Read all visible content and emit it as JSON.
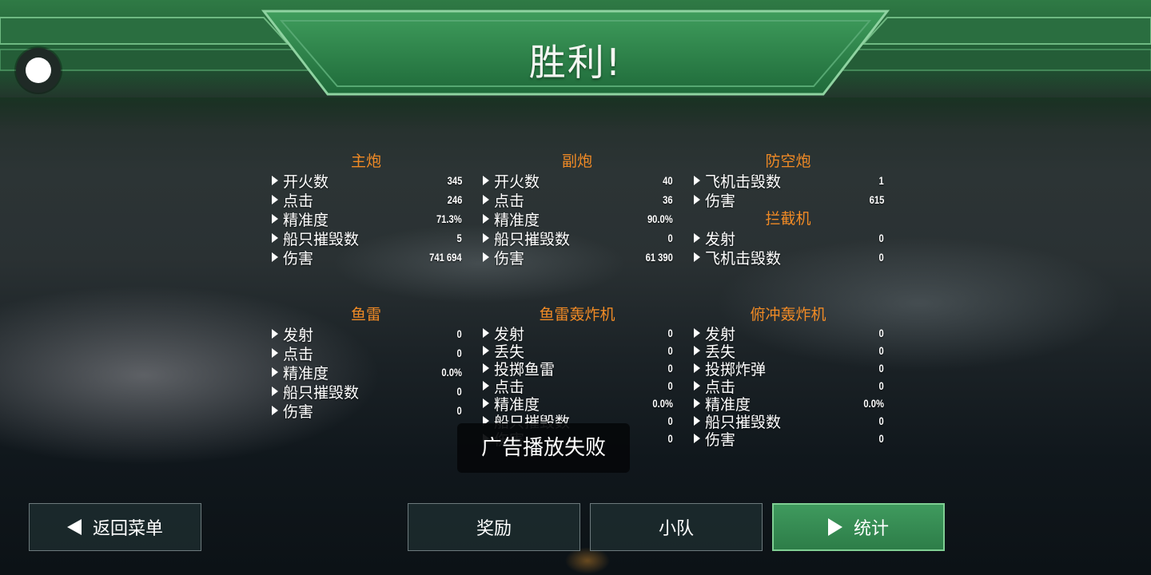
{
  "header": {
    "title": "胜利!"
  },
  "sections": {
    "main_gun": {
      "title": "主炮",
      "rows": [
        {
          "label": "开火数",
          "value": "345"
        },
        {
          "label": "点击",
          "value": "246"
        },
        {
          "label": "精准度",
          "value": "71.3%"
        },
        {
          "label": "船只摧毁数",
          "value": "5"
        },
        {
          "label": "伤害",
          "value": "741 694"
        }
      ]
    },
    "secondary_gun": {
      "title": "副炮",
      "rows": [
        {
          "label": "开火数",
          "value": "40"
        },
        {
          "label": "点击",
          "value": "36"
        },
        {
          "label": "精准度",
          "value": "90.0%"
        },
        {
          "label": "船只摧毁数",
          "value": "0"
        },
        {
          "label": "伤害",
          "value": "61 390"
        }
      ]
    },
    "anti_air": {
      "title": "防空炮",
      "rows": [
        {
          "label": "飞机击毁数",
          "value": "1"
        },
        {
          "label": "伤害",
          "value": "615"
        }
      ]
    },
    "interceptor": {
      "title": "拦截机",
      "rows": [
        {
          "label": "发射",
          "value": "0"
        },
        {
          "label": "飞机击毁数",
          "value": "0"
        }
      ]
    },
    "torpedo": {
      "title": "鱼雷",
      "rows": [
        {
          "label": "发射",
          "value": "0"
        },
        {
          "label": "点击",
          "value": "0"
        },
        {
          "label": "精准度",
          "value": "0.0%"
        },
        {
          "label": "船只摧毁数",
          "value": "0"
        },
        {
          "label": "伤害",
          "value": "0"
        }
      ]
    },
    "torpedo_bomber": {
      "title": "鱼雷轰炸机",
      "rows": [
        {
          "label": "发射",
          "value": "0"
        },
        {
          "label": "丢失",
          "value": "0"
        },
        {
          "label": "投掷鱼雷",
          "value": "0"
        },
        {
          "label": "点击",
          "value": "0"
        },
        {
          "label": "精准度",
          "value": "0.0%"
        },
        {
          "label": "船只摧毁数",
          "value": "0"
        },
        {
          "label": "伤害",
          "value": "0"
        }
      ]
    },
    "dive_bomber": {
      "title": "俯冲轰炸机",
      "rows": [
        {
          "label": "发射",
          "value": "0"
        },
        {
          "label": "丢失",
          "value": "0"
        },
        {
          "label": "投掷炸弹",
          "value": "0"
        },
        {
          "label": "点击",
          "value": "0"
        },
        {
          "label": "精准度",
          "value": "0.0%"
        },
        {
          "label": "船只摧毁数",
          "value": "0"
        },
        {
          "label": "伤害",
          "value": "0"
        }
      ]
    }
  },
  "toast": {
    "text": "广告播放失败"
  },
  "buttons": {
    "back": "返回菜单",
    "rewards": "奖励",
    "squad": "小队",
    "stats": "统计"
  },
  "colors": {
    "accent_green": "#2d7d48",
    "section_title_orange": "#f08a25"
  },
  "icons": {
    "settings": "settings-circle-icon",
    "back": "arrow-left-icon",
    "stats": "play-arrow-icon",
    "row_bullet": "triangle-right-icon"
  }
}
